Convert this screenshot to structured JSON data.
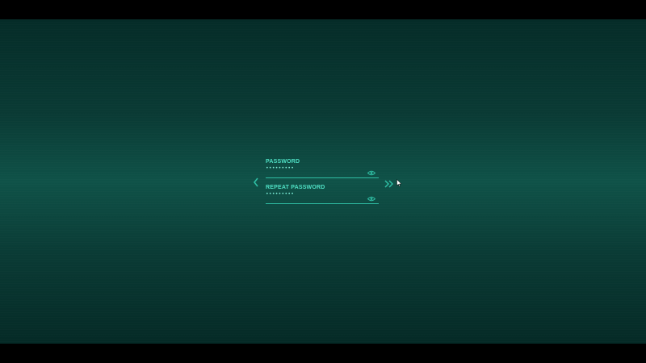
{
  "colors": {
    "accent": "#2fbea4",
    "text": "#4fe0c4",
    "background": "#0f5248"
  },
  "form": {
    "password": {
      "label": "PASSWORD",
      "value": "•••••••••",
      "toggle_icon": "eye-icon"
    },
    "repeat_password": {
      "label": "REPEAT PASSWORD",
      "value": "•••••••••",
      "toggle_icon": "eye-icon"
    }
  },
  "navigation": {
    "back_icon": "chevron-left-icon",
    "next_icon": "double-chevron-right-icon"
  },
  "cursor": {
    "icon": "mouse-pointer-icon"
  }
}
